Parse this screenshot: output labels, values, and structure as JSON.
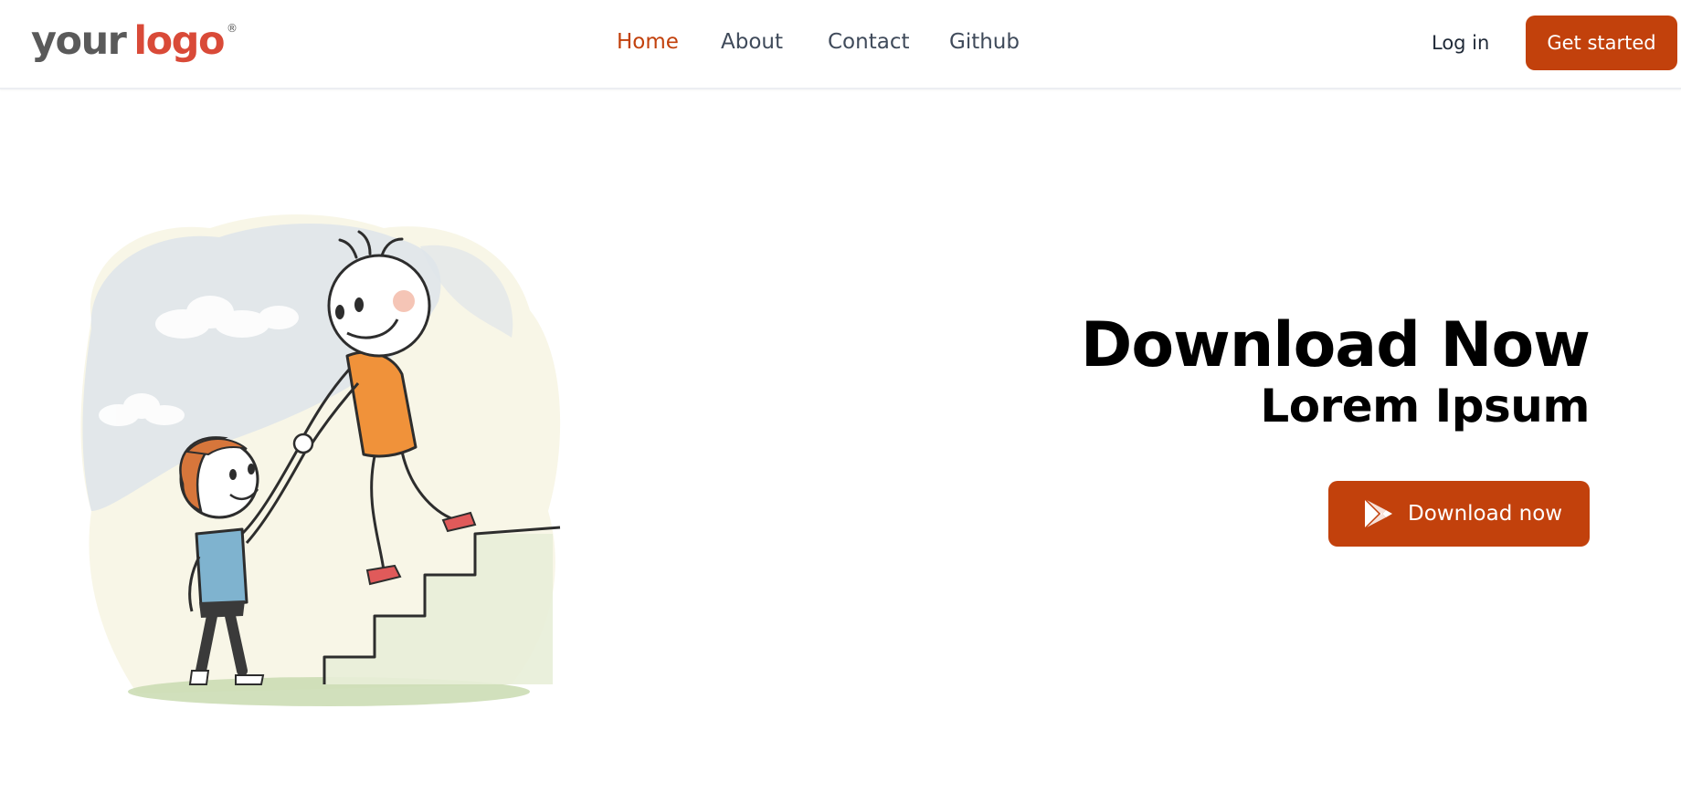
{
  "logo": {
    "word1": "your",
    "word2": "logo",
    "mark": "®",
    "colors": {
      "word1": "#5a5a5a",
      "word2": "#d94a38"
    }
  },
  "nav": {
    "items": [
      {
        "label": "Home",
        "active": true
      },
      {
        "label": "About",
        "active": false
      },
      {
        "label": "Contact",
        "active": false
      },
      {
        "label": "Github",
        "active": false
      }
    ],
    "login_label": "Log in",
    "cta_label": "Get started"
  },
  "hero": {
    "title": "Download Now",
    "subtitle": "Lorem Ipsum",
    "download_button": {
      "label": "Download now",
      "icon": "google-play-icon"
    },
    "illustration": "helping-hand-stairs-illustration"
  },
  "colors": {
    "accent": "#c2410c",
    "nav_text": "#3f4a5a",
    "heading": "#000000",
    "background": "#ffffff"
  }
}
